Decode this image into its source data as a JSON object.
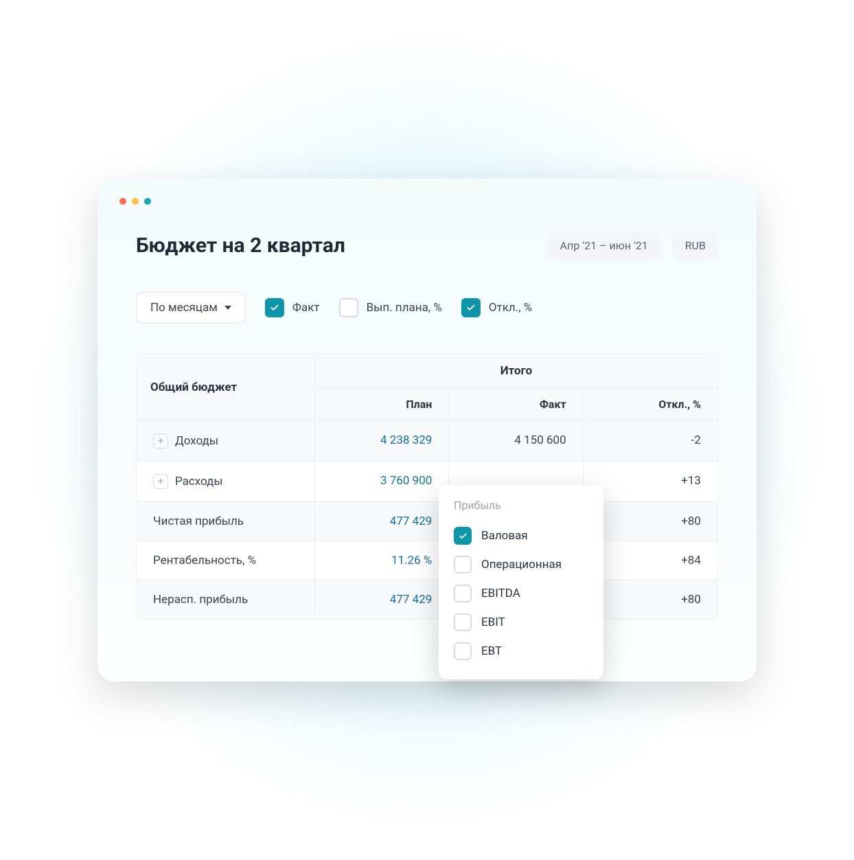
{
  "header": {
    "title": "Бюджет на 2 квартал",
    "period": "Апр '21 – июн '21",
    "currency": "RUB"
  },
  "controls": {
    "group_by": "По месяцам",
    "options": [
      {
        "label": "Факт",
        "checked": true
      },
      {
        "label": "Вып. плана, %",
        "checked": false
      },
      {
        "label": "Откл., %",
        "checked": true
      }
    ]
  },
  "table": {
    "corner_label": "Общий бюджет",
    "group_header": "Итого",
    "columns": [
      "План",
      "Факт",
      "Откл., %"
    ],
    "rows": [
      {
        "label": "Доходы",
        "expandable": true,
        "plan": "4 238 329",
        "fact": "4 150 600",
        "dev": "-2",
        "shaded": true
      },
      {
        "label": "Расходы",
        "expandable": true,
        "plan": "3 760 900",
        "fact": "",
        "dev": "+13",
        "shaded": false
      },
      {
        "label": "Чистая прибыль",
        "expandable": false,
        "plan": "477 429",
        "fact": "",
        "dev": "+80",
        "shaded": true
      },
      {
        "label": "Рентабельность, %",
        "expandable": false,
        "plan": "11.26 %",
        "fact": "",
        "dev": "+84",
        "shaded": false
      },
      {
        "label": "Нерасп. прибыль",
        "expandable": false,
        "plan": "477 429",
        "fact": "",
        "dev": "+80",
        "shaded": true
      }
    ]
  },
  "popup": {
    "title": "Прибыль",
    "options": [
      {
        "label": "Валовая",
        "checked": true
      },
      {
        "label": "Операционная",
        "checked": false
      },
      {
        "label": "EBITDA",
        "checked": false
      },
      {
        "label": "EBIT",
        "checked": false
      },
      {
        "label": "EBT",
        "checked": false
      }
    ]
  }
}
